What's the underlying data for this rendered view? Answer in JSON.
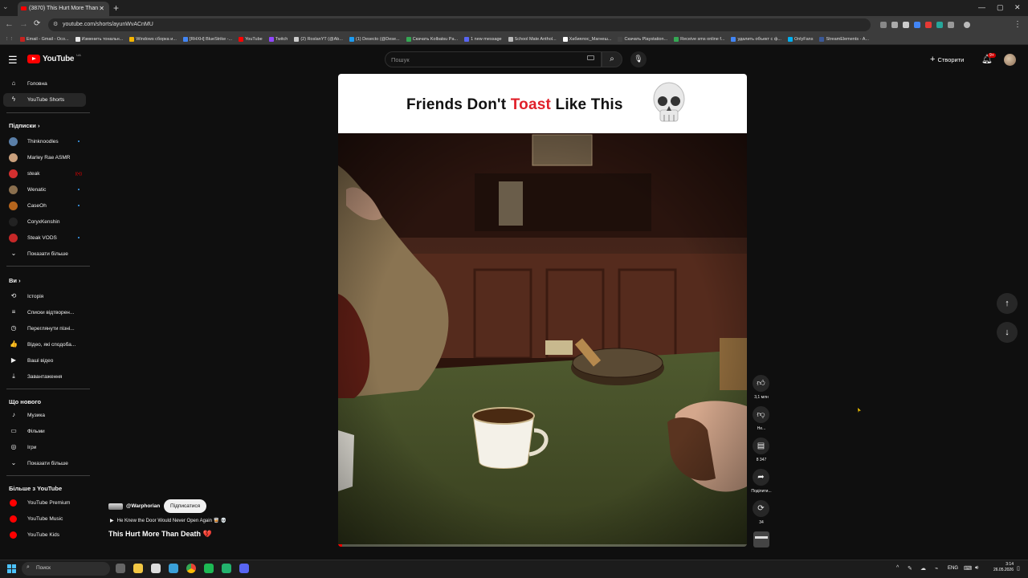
{
  "browser": {
    "tab_title": "(3870) This Hurt More Than",
    "url": "youtube.com/shorts/ayunWvACnMU",
    "bookmarks": [
      {
        "label": "Email - Gmail - Осо...",
        "color": "#c5221f"
      },
      {
        "label": "Изменить тональн...",
        "color": "#e8e8e8"
      },
      {
        "label": "Windows сборка и...",
        "color": "#f4b400"
      },
      {
        "label": "[RHXH] BlueStrike -...",
        "color": "#4285f4"
      },
      {
        "label": "YouTube",
        "color": "#ff0000"
      },
      {
        "label": "Twitch",
        "color": "#9146ff"
      },
      {
        "label": "(2) RoslanYT (@Ab...",
        "color": "#cccccc"
      },
      {
        "label": "(1) Desecto (@Dese...",
        "color": "#1d9bf0"
      },
      {
        "label": "Скачать Kolbatsu Pa...",
        "color": "#34a853"
      },
      {
        "label": "1 new message",
        "color": "#5865f2"
      },
      {
        "label": "School Mate Anthol...",
        "color": "#bbbbbb"
      },
      {
        "label": "Хабиялос_Магнеш...",
        "color": "#ffffff"
      },
      {
        "label": "Скачать Playstation...",
        "color": "#444444"
      },
      {
        "label": "Receive sms online f...",
        "color": "#34a853"
      },
      {
        "label": "удалить объект с ф...",
        "color": "#4285f4"
      },
      {
        "label": "OnlyFans",
        "color": "#00aff0"
      },
      {
        "label": "StreamElements - A...",
        "color": "#3b5998"
      }
    ]
  },
  "header": {
    "logo_text": "YouTube",
    "logo_country": "UA",
    "search_placeholder": "Пошук",
    "create_label": "Створити",
    "notification_count": "9+"
  },
  "sidebar": {
    "main": [
      {
        "label": "Головна",
        "icon": "home-icon",
        "glyph": "⌂"
      },
      {
        "label": "YouTube Shorts",
        "icon": "shorts-icon",
        "glyph": "ϟ",
        "active": true
      }
    ],
    "subscriptions_heading": "Підписки",
    "subscriptions": [
      {
        "label": "Thinknoodles",
        "color": "#5a7fa8",
        "dot": true
      },
      {
        "label": "Marley Rae ASMR",
        "color": "#c9a07d",
        "dot": false
      },
      {
        "label": "steak",
        "color": "#d32f2f",
        "live": true
      },
      {
        "label": "Wenatic",
        "color": "#8a6f4e",
        "dot": true
      },
      {
        "label": "CaseOh",
        "color": "#b5651d",
        "dot": true
      },
      {
        "label": "CoryxKenshin",
        "color": "#222222",
        "dot": false
      },
      {
        "label": "Steak VODS",
        "color": "#c62828",
        "dot": true
      }
    ],
    "show_more_subs": "Показати більше",
    "you_heading": "Ви",
    "you_items": [
      {
        "label": "Історія",
        "icon": "history-icon",
        "glyph": "⟲"
      },
      {
        "label": "Списки відтворен...",
        "icon": "playlists-icon",
        "glyph": "≡"
      },
      {
        "label": "Переглянути пізні...",
        "icon": "watch-later-icon",
        "glyph": "◷"
      },
      {
        "label": "Відео, які сподоба...",
        "icon": "liked-icon",
        "glyph": "👍"
      },
      {
        "label": "Ваші відео",
        "icon": "your-videos-icon",
        "glyph": "▶"
      },
      {
        "label": "Завантаження",
        "icon": "downloads-icon",
        "glyph": "⤓"
      }
    ],
    "explore_heading": "Що нового",
    "explore_items": [
      {
        "label": "Музика",
        "icon": "music-icon",
        "glyph": "♪"
      },
      {
        "label": "Фільми",
        "icon": "movies-icon",
        "glyph": "▭"
      },
      {
        "label": "Ігри",
        "icon": "gaming-icon",
        "glyph": "◎"
      }
    ],
    "show_more_explore": "Показати більше",
    "more_heading": "Більше з YouTube",
    "more_items": [
      {
        "label": "YouTube Premium",
        "icon": "yt-premium-icon"
      },
      {
        "label": "YouTube Music",
        "icon": "yt-music-icon"
      },
      {
        "label": "YouTube Kids",
        "icon": "yt-kids-icon"
      }
    ]
  },
  "short": {
    "banner_part1": "Friends Don't ",
    "banner_red": "Toast",
    "banner_part2": " Like This",
    "channel": "@Warphorian",
    "subscribe_label": "Підписатися",
    "music_line": "He Knew the Door Would Never Open Again 🥃 💀",
    "title": "This Hurt More Than Death",
    "title_emoji": "💔",
    "progress": 0.01,
    "actions": {
      "like_count": "3,1 млн",
      "dislike_label": "Не...",
      "comment_count": "8 347",
      "share_label": "Поділити...",
      "remix_count": "34"
    }
  },
  "taskbar": {
    "search_placeholder": "Поиск",
    "lang": "ENG",
    "time": "3:14",
    "date": "26.05.2026"
  },
  "colors": {
    "accent_red": "#ff0000",
    "background": "#0f0f0f",
    "surface": "#272727"
  }
}
